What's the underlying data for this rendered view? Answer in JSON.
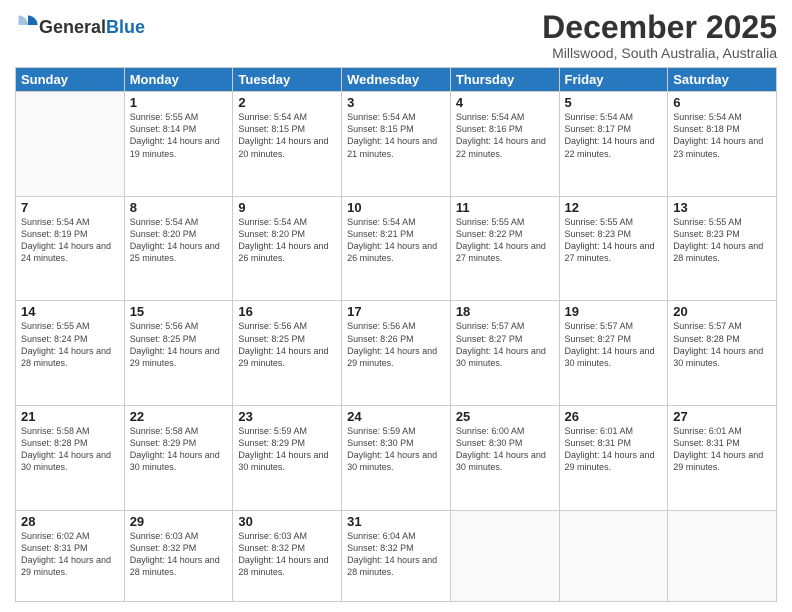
{
  "header": {
    "logo": {
      "general": "General",
      "blue": "Blue"
    },
    "title": "December 2025",
    "subtitle": "Millswood, South Australia, Australia"
  },
  "weekdays": [
    "Sunday",
    "Monday",
    "Tuesday",
    "Wednesday",
    "Thursday",
    "Friday",
    "Saturday"
  ],
  "weeks": [
    [
      {
        "day": "",
        "sunrise": "",
        "sunset": "",
        "daylight": ""
      },
      {
        "day": "1",
        "sunrise": "Sunrise: 5:55 AM",
        "sunset": "Sunset: 8:14 PM",
        "daylight": "Daylight: 14 hours and 19 minutes."
      },
      {
        "day": "2",
        "sunrise": "Sunrise: 5:54 AM",
        "sunset": "Sunset: 8:15 PM",
        "daylight": "Daylight: 14 hours and 20 minutes."
      },
      {
        "day": "3",
        "sunrise": "Sunrise: 5:54 AM",
        "sunset": "Sunset: 8:15 PM",
        "daylight": "Daylight: 14 hours and 21 minutes."
      },
      {
        "day": "4",
        "sunrise": "Sunrise: 5:54 AM",
        "sunset": "Sunset: 8:16 PM",
        "daylight": "Daylight: 14 hours and 22 minutes."
      },
      {
        "day": "5",
        "sunrise": "Sunrise: 5:54 AM",
        "sunset": "Sunset: 8:17 PM",
        "daylight": "Daylight: 14 hours and 22 minutes."
      },
      {
        "day": "6",
        "sunrise": "Sunrise: 5:54 AM",
        "sunset": "Sunset: 8:18 PM",
        "daylight": "Daylight: 14 hours and 23 minutes."
      }
    ],
    [
      {
        "day": "7",
        "sunrise": "Sunrise: 5:54 AM",
        "sunset": "Sunset: 8:19 PM",
        "daylight": "Daylight: 14 hours and 24 minutes."
      },
      {
        "day": "8",
        "sunrise": "Sunrise: 5:54 AM",
        "sunset": "Sunset: 8:20 PM",
        "daylight": "Daylight: 14 hours and 25 minutes."
      },
      {
        "day": "9",
        "sunrise": "Sunrise: 5:54 AM",
        "sunset": "Sunset: 8:20 PM",
        "daylight": "Daylight: 14 hours and 26 minutes."
      },
      {
        "day": "10",
        "sunrise": "Sunrise: 5:54 AM",
        "sunset": "Sunset: 8:21 PM",
        "daylight": "Daylight: 14 hours and 26 minutes."
      },
      {
        "day": "11",
        "sunrise": "Sunrise: 5:55 AM",
        "sunset": "Sunset: 8:22 PM",
        "daylight": "Daylight: 14 hours and 27 minutes."
      },
      {
        "day": "12",
        "sunrise": "Sunrise: 5:55 AM",
        "sunset": "Sunset: 8:23 PM",
        "daylight": "Daylight: 14 hours and 27 minutes."
      },
      {
        "day": "13",
        "sunrise": "Sunrise: 5:55 AM",
        "sunset": "Sunset: 8:23 PM",
        "daylight": "Daylight: 14 hours and 28 minutes."
      }
    ],
    [
      {
        "day": "14",
        "sunrise": "Sunrise: 5:55 AM",
        "sunset": "Sunset: 8:24 PM",
        "daylight": "Daylight: 14 hours and 28 minutes."
      },
      {
        "day": "15",
        "sunrise": "Sunrise: 5:56 AM",
        "sunset": "Sunset: 8:25 PM",
        "daylight": "Daylight: 14 hours and 29 minutes."
      },
      {
        "day": "16",
        "sunrise": "Sunrise: 5:56 AM",
        "sunset": "Sunset: 8:25 PM",
        "daylight": "Daylight: 14 hours and 29 minutes."
      },
      {
        "day": "17",
        "sunrise": "Sunrise: 5:56 AM",
        "sunset": "Sunset: 8:26 PM",
        "daylight": "Daylight: 14 hours and 29 minutes."
      },
      {
        "day": "18",
        "sunrise": "Sunrise: 5:57 AM",
        "sunset": "Sunset: 8:27 PM",
        "daylight": "Daylight: 14 hours and 30 minutes."
      },
      {
        "day": "19",
        "sunrise": "Sunrise: 5:57 AM",
        "sunset": "Sunset: 8:27 PM",
        "daylight": "Daylight: 14 hours and 30 minutes."
      },
      {
        "day": "20",
        "sunrise": "Sunrise: 5:57 AM",
        "sunset": "Sunset: 8:28 PM",
        "daylight": "Daylight: 14 hours and 30 minutes."
      }
    ],
    [
      {
        "day": "21",
        "sunrise": "Sunrise: 5:58 AM",
        "sunset": "Sunset: 8:28 PM",
        "daylight": "Daylight: 14 hours and 30 minutes."
      },
      {
        "day": "22",
        "sunrise": "Sunrise: 5:58 AM",
        "sunset": "Sunset: 8:29 PM",
        "daylight": "Daylight: 14 hours and 30 minutes."
      },
      {
        "day": "23",
        "sunrise": "Sunrise: 5:59 AM",
        "sunset": "Sunset: 8:29 PM",
        "daylight": "Daylight: 14 hours and 30 minutes."
      },
      {
        "day": "24",
        "sunrise": "Sunrise: 5:59 AM",
        "sunset": "Sunset: 8:30 PM",
        "daylight": "Daylight: 14 hours and 30 minutes."
      },
      {
        "day": "25",
        "sunrise": "Sunrise: 6:00 AM",
        "sunset": "Sunset: 8:30 PM",
        "daylight": "Daylight: 14 hours and 30 minutes."
      },
      {
        "day": "26",
        "sunrise": "Sunrise: 6:01 AM",
        "sunset": "Sunset: 8:31 PM",
        "daylight": "Daylight: 14 hours and 29 minutes."
      },
      {
        "day": "27",
        "sunrise": "Sunrise: 6:01 AM",
        "sunset": "Sunset: 8:31 PM",
        "daylight": "Daylight: 14 hours and 29 minutes."
      }
    ],
    [
      {
        "day": "28",
        "sunrise": "Sunrise: 6:02 AM",
        "sunset": "Sunset: 8:31 PM",
        "daylight": "Daylight: 14 hours and 29 minutes."
      },
      {
        "day": "29",
        "sunrise": "Sunrise: 6:03 AM",
        "sunset": "Sunset: 8:32 PM",
        "daylight": "Daylight: 14 hours and 28 minutes."
      },
      {
        "day": "30",
        "sunrise": "Sunrise: 6:03 AM",
        "sunset": "Sunset: 8:32 PM",
        "daylight": "Daylight: 14 hours and 28 minutes."
      },
      {
        "day": "31",
        "sunrise": "Sunrise: 6:04 AM",
        "sunset": "Sunset: 8:32 PM",
        "daylight": "Daylight: 14 hours and 28 minutes."
      },
      {
        "day": "",
        "sunrise": "",
        "sunset": "",
        "daylight": ""
      },
      {
        "day": "",
        "sunrise": "",
        "sunset": "",
        "daylight": ""
      },
      {
        "day": "",
        "sunrise": "",
        "sunset": "",
        "daylight": ""
      }
    ]
  ]
}
